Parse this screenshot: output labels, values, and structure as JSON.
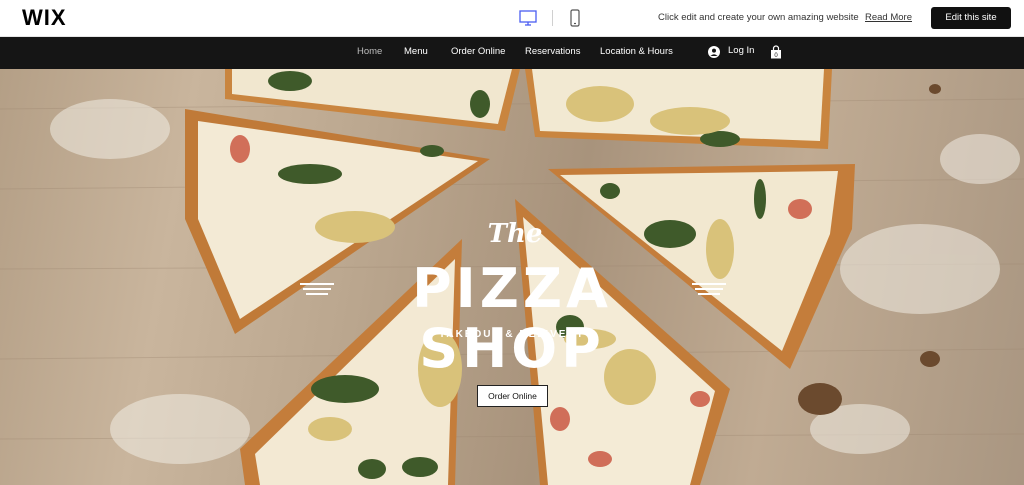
{
  "wix_bar": {
    "logo": "WIX",
    "icons": [
      "desktop-icon",
      "mobile-icon"
    ],
    "promo_text": "Click edit and create your own amazing website",
    "read_more": "Read More",
    "edit_button": "Edit this site"
  },
  "nav": {
    "items": [
      {
        "label": "Home",
        "active": true
      },
      {
        "label": "Menu",
        "active": false
      },
      {
        "label": "Order Online",
        "active": false
      },
      {
        "label": "Reservations",
        "active": false
      },
      {
        "label": "Location & Hours",
        "active": false
      }
    ],
    "login_label": "Log In",
    "icons": [
      "user-icon",
      "cart-icon"
    ]
  },
  "hero": {
    "title_small": "The",
    "title_main": "PIZZA SHOP",
    "subtitle": "TAKEOUT & DELIVERY",
    "button": "Order Online"
  },
  "colors": {
    "nav_background": "#151515",
    "edit_button_background": "#111111",
    "accent_device_icon": "#4a5df0"
  }
}
